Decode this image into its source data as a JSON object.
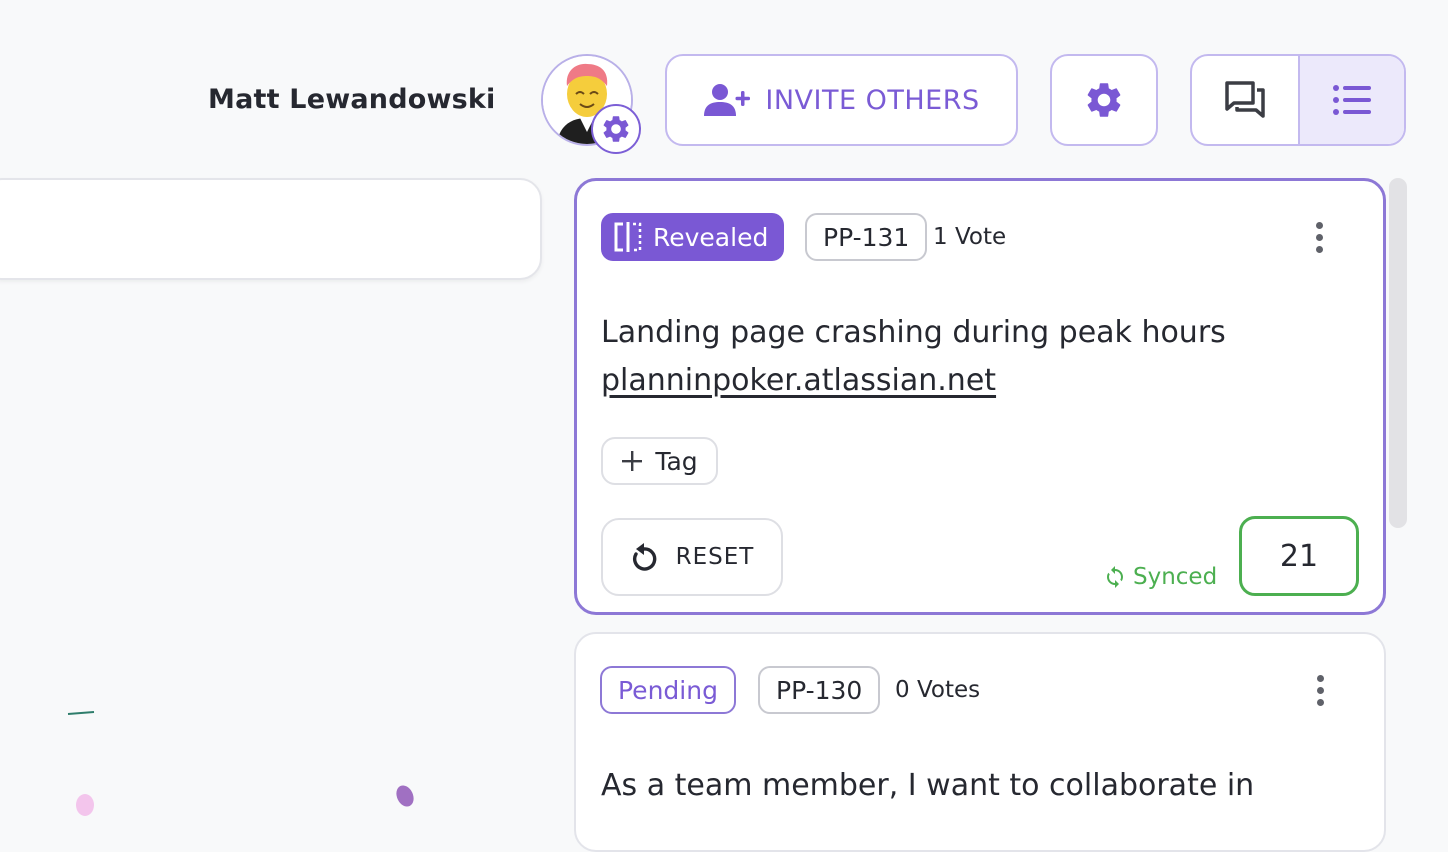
{
  "header": {
    "user_name": "Matt Lewandowski",
    "invite_label": "INVITE OTHERS"
  },
  "issues": [
    {
      "status": "Revealed",
      "key": "PP-131",
      "votes": "1 Vote",
      "title": "Landing page crashing during peak hours",
      "link": "planninpoker.atlassian.net",
      "tag_label": "Tag",
      "reset_label": "RESET",
      "sync_status": "Synced",
      "estimate": "21"
    },
    {
      "status": "Pending",
      "key": "PP-130",
      "votes": "0 Votes",
      "title": "As a team member, I want to collaborate in"
    }
  ],
  "icons": {
    "avatar": "avatar-emoji",
    "avatar_settings": "gear-icon",
    "invite": "user-plus-icon",
    "settings": "gear-icon",
    "chat_view": "chat-icon",
    "list_view": "list-icon",
    "revealed": "reveal-icon",
    "kebab": "more-vertical-icon",
    "add_tag": "plus-icon",
    "reset": "reset-icon",
    "synced": "sync-icon"
  },
  "colors": {
    "accent": "#7a58d4",
    "accent_light": "#ece9fb",
    "success": "#4caf50",
    "text": "#262830"
  }
}
